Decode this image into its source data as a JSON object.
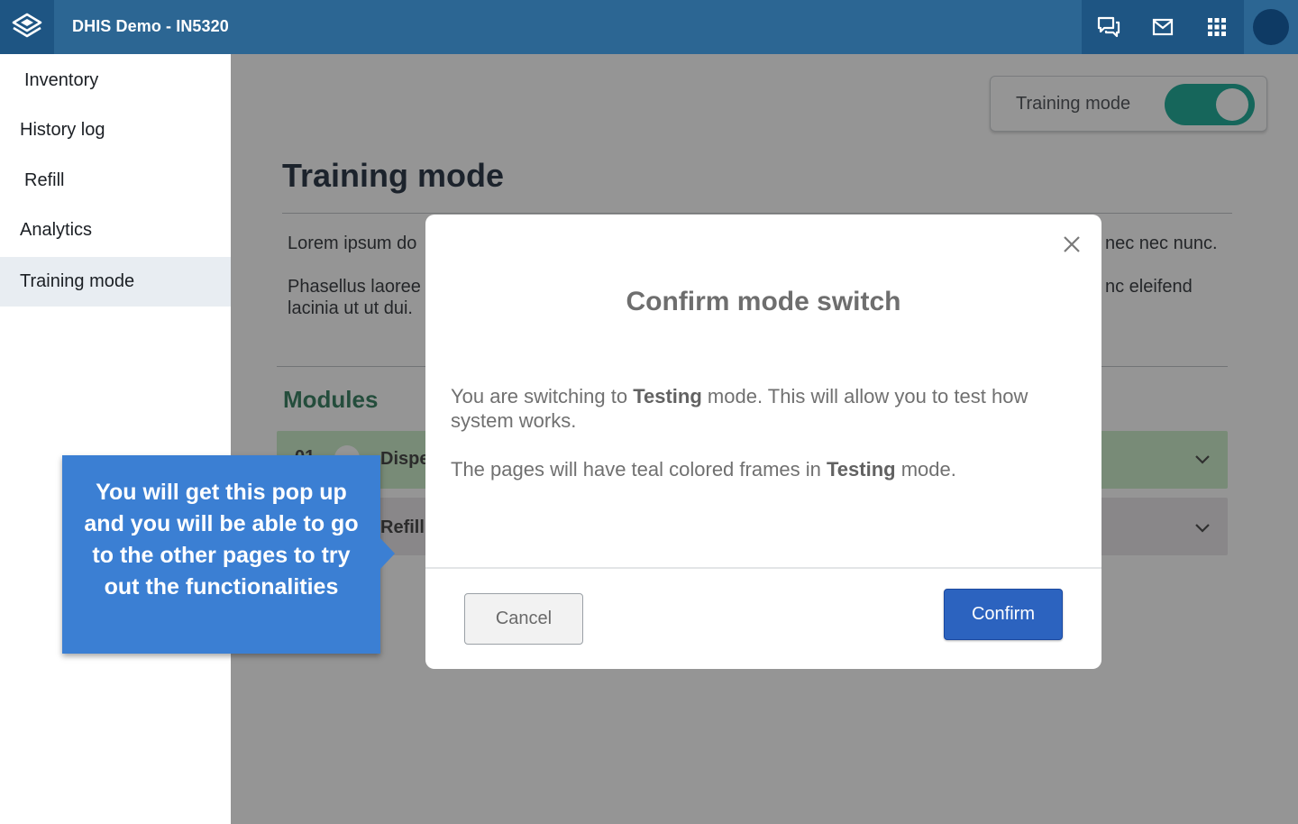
{
  "header": {
    "app_title": "DHIS Demo - IN5320",
    "icons": [
      "layers-logo-icon",
      "chat-icon",
      "mail-icon",
      "apps-grid-icon",
      "user-avatar"
    ]
  },
  "sidebar": {
    "items": [
      {
        "label": "Inventory",
        "active": false
      },
      {
        "label": "History log",
        "active": false
      },
      {
        "label": "Refill",
        "active": false
      },
      {
        "label": "Analytics",
        "active": false
      },
      {
        "label": "Training mode",
        "active": true
      }
    ]
  },
  "main": {
    "toggle": {
      "label": "Training mode",
      "on": true,
      "color": "#00a18a"
    },
    "title": "Training mode",
    "paragraph1": "Lorem ipsum do",
    "paragraph1_tail": "nec nec nunc.",
    "paragraph2_line1": "Phasellus laoree",
    "paragraph2_tail": "nc eleifend",
    "paragraph2_line2": "lacinia ut ut dui.",
    "modules_title": "Modules",
    "modules": [
      {
        "num": "01",
        "name": "Dispe",
        "color": "#c5ebc2"
      },
      {
        "name": "Refill",
        "color": "#e6e3e6"
      }
    ]
  },
  "modal": {
    "title": "Confirm mode switch",
    "body1_a": "You are switching to ",
    "body1_bold": "Testing",
    "body1_b": " mode. This will allow you to test how system works.",
    "body2_a": "The pages will have teal colored frames in ",
    "body2_bold": "Testing",
    "body2_b": " mode.",
    "cancel_label": "Cancel",
    "confirm_label": "Confirm",
    "confirm_color": "#2c63bf"
  },
  "callout": {
    "text": "You will get this pop up and you will be able to go to the other pages to try out the functionalities",
    "color": "#3b7fd3"
  }
}
